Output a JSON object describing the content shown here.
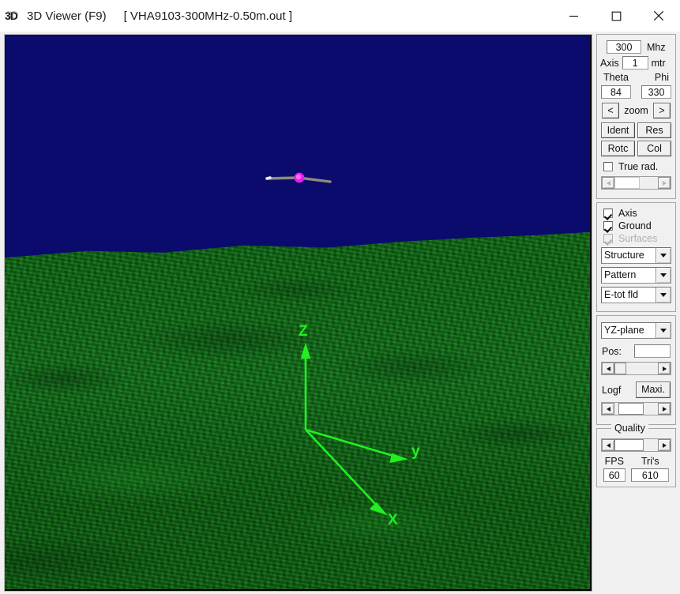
{
  "titlebar": {
    "icon_label": "3D",
    "app_title": "3D Viewer (F9)",
    "file_title": "[ VHA9103-300MHz-0.50m.out ]",
    "minimize": "minimize-icon",
    "maximize": "maximize-icon",
    "close": "close-icon"
  },
  "viewport": {
    "sky_color": "#0b0b6e",
    "ground_color": "#127a16",
    "axis_color": "#22ee22",
    "wire_color": "#9a9a84",
    "source_color": "#e81ee8",
    "axis_labels": {
      "x": "X",
      "y": "y",
      "z": "Z"
    }
  },
  "panel": {
    "frequency": {
      "value": "300",
      "unit": "Mhz"
    },
    "axis": {
      "label": "Axis",
      "value": "1",
      "unit": "mtr"
    },
    "angles": {
      "theta_label": "Theta",
      "phi_label": "Phi",
      "theta_value": "84",
      "phi_value": "330"
    },
    "zoom": {
      "prev": "<",
      "label": "zoom",
      "next": ">"
    },
    "buttons": {
      "ident": "Ident",
      "res": "Res",
      "rotc": "Rotc",
      "col": "Col",
      "maxi": "Maxi."
    },
    "true_rad": {
      "label": "True rad.",
      "checked": false
    },
    "true_rad_slider": {
      "value": 0
    },
    "checks": [
      {
        "label": "Axis",
        "checked": true,
        "disabled": false
      },
      {
        "label": "Ground",
        "checked": true,
        "disabled": false
      },
      {
        "label": "Surfaces",
        "checked": true,
        "disabled": true
      }
    ],
    "combos": [
      {
        "name": "structure",
        "value": "Structure"
      },
      {
        "name": "pattern",
        "value": "Pattern"
      },
      {
        "name": "field",
        "value": "E-tot fld"
      }
    ],
    "plane": {
      "value": "YZ-plane"
    },
    "pos": {
      "label": "Pos:",
      "value": ""
    },
    "logf": {
      "label": "Logf"
    },
    "quality": {
      "legend": "Quality",
      "fps_label": "FPS",
      "tris_label": "Tri's",
      "fps_value": "60",
      "tris_value": "610"
    }
  }
}
